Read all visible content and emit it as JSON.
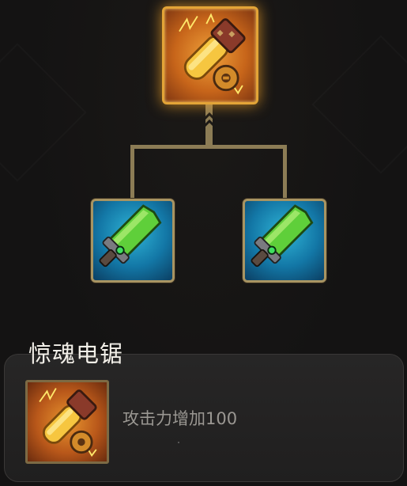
{
  "tree": {
    "root": {
      "icon": "chainsaw-icon",
      "border_color": "#e3a437",
      "glow_color": "#ffaa28"
    },
    "children": [
      {
        "icon": "green-cleaver-icon",
        "border_color": "#a89462"
      },
      {
        "icon": "green-cleaver-icon",
        "border_color": "#a89462"
      }
    ],
    "connector_color": "#8c7c55"
  },
  "detail_panel": {
    "title": "惊魂电锯",
    "icon": "chainsaw-icon",
    "description": "攻击力增加100"
  }
}
